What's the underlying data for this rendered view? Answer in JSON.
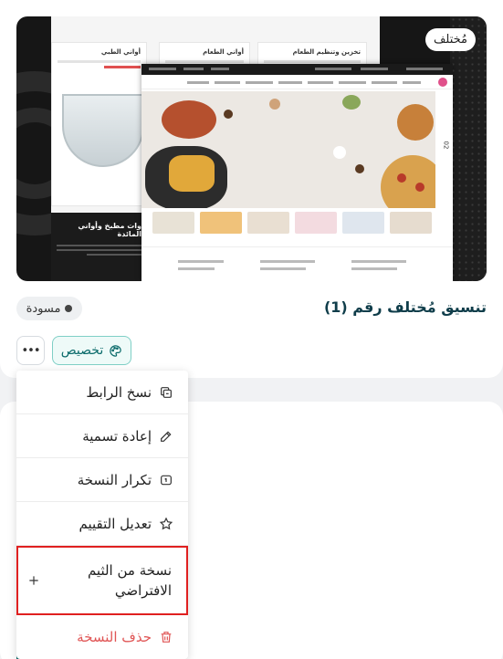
{
  "theme": {
    "badge": "مُختلف",
    "title": "تنسيق مُختلف رقم (1)",
    "status": "مسودة",
    "customize_label": "تخصيص",
    "more_label": "•••"
  },
  "preview": {
    "col_titles": [
      "أواني الطبي",
      "أواني الطعام",
      "تخزين وتنظيم الطعام"
    ],
    "dark_title": "وات مطبخ وأواني المائدة",
    "slide_number": "02"
  },
  "menu": {
    "items": [
      {
        "label": "نسخ الرابط",
        "icon": "copy-link-icon"
      },
      {
        "label": "إعادة تسمية",
        "icon": "pencil-icon"
      },
      {
        "label": "تكرار النسخة",
        "icon": "duplicate-icon"
      },
      {
        "label": "تعديل التقييم",
        "icon": "star-icon"
      },
      {
        "label": "نسخة من الثيم الافتراضي",
        "icon": "plus-icon"
      },
      {
        "label": "حذف النسخة",
        "icon": "trash-icon"
      }
    ]
  },
  "colors": {
    "accent": "#0b6b6b",
    "title": "#0f3d4a",
    "danger": "#e05555",
    "highlight_border": "#e02020"
  }
}
